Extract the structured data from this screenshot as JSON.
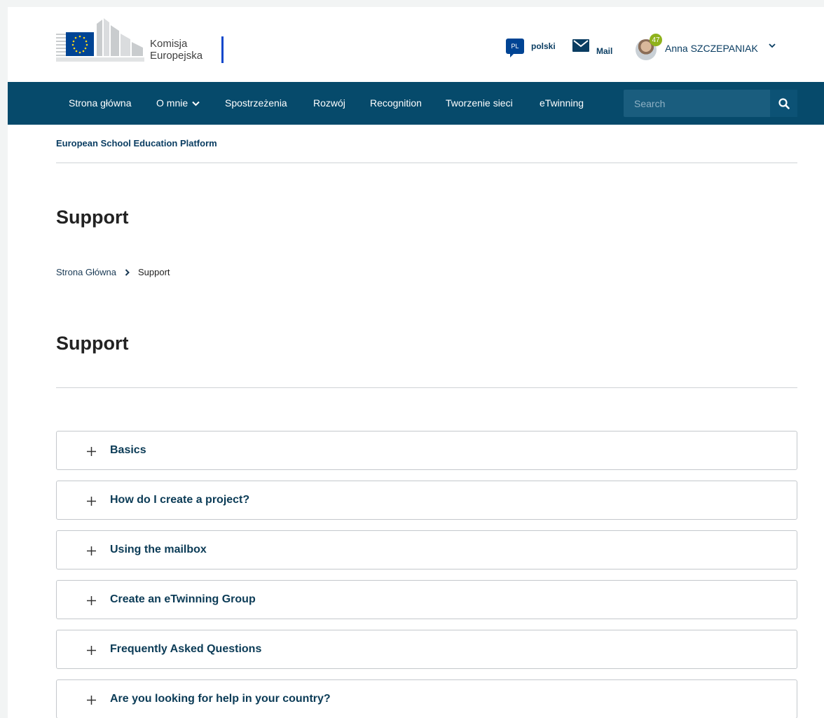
{
  "header": {
    "logo_line1": "Komisja",
    "logo_line2": "Europejska",
    "language_code": "PL",
    "language_label": "polski",
    "mail_label": "Mail",
    "notification_count": "47",
    "user_name": "Anna SZCZEPANIAK"
  },
  "nav": {
    "items": [
      {
        "label": "Strona główna"
      },
      {
        "label": "O mnie"
      },
      {
        "label": "Spostrzeżenia"
      },
      {
        "label": "Rozwój"
      },
      {
        "label": "Recognition"
      },
      {
        "label": "Tworzenie sieci"
      },
      {
        "label": "eTwinning"
      }
    ],
    "search_placeholder": "Search"
  },
  "site_name": "European School Education Platform",
  "page_title": "Support",
  "breadcrumb": {
    "home": "Strona Główna",
    "current": "Support"
  },
  "section_title": "Support",
  "accordion": {
    "items": [
      {
        "label": "Basics"
      },
      {
        "label": "How do I create a project?"
      },
      {
        "label": "Using the mailbox"
      },
      {
        "label": "Create an eTwinning Group"
      },
      {
        "label": "Frequently Asked Questions"
      },
      {
        "label": "Are you looking for help in your country?"
      }
    ]
  },
  "colors": {
    "nav_background": "#064a6b",
    "accent_blue": "#0e47cb",
    "notification_badge": "#8fb21c"
  }
}
